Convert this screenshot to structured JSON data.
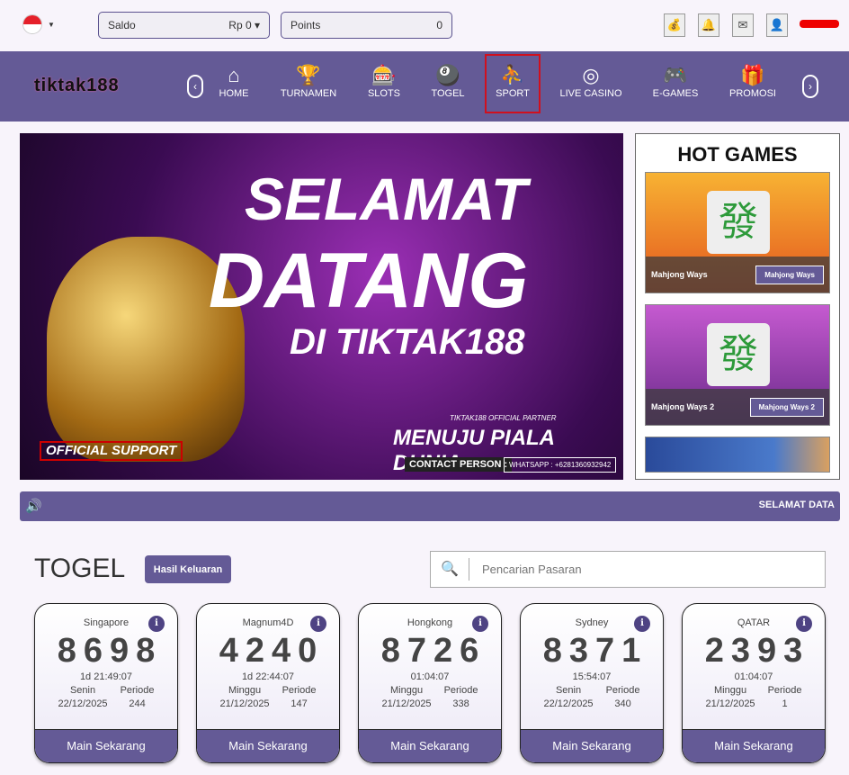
{
  "header": {
    "saldo_label": "Saldo",
    "saldo_value": "Rp 0 ▾",
    "points_label": "Points",
    "points_value": "0"
  },
  "nav": {
    "logo": "tiktak188",
    "items": [
      {
        "label": "HOME",
        "icon": "⌂"
      },
      {
        "label": "TURNAMEN",
        "icon": "🏆"
      },
      {
        "label": "SLOTS",
        "icon": "🎰"
      },
      {
        "label": "TOGEL",
        "icon": "🎱"
      },
      {
        "label": "SPORT",
        "icon": "⛹"
      },
      {
        "label": "LIVE CASINO",
        "icon": "◎"
      },
      {
        "label": "E-GAMES",
        "icon": "🎮"
      },
      {
        "label": "PROMOSI",
        "icon": "🎁"
      }
    ]
  },
  "banner": {
    "line1": "SELAMAT",
    "line2": "DATANG",
    "line3": "DI TIKTAK188",
    "partner": "TIKTAK188 OFFICIAL PARTNER",
    "line4": "MENUJU PIALA DUNIA",
    "contact": "CONTACT PERSON :",
    "whatsapp": "WHATSAPP : +6281360932942",
    "support": "OFFICIAL SUPPORT"
  },
  "hot_games": {
    "title": "HOT GAMES",
    "games": [
      {
        "name": "Mahjong Ways",
        "button": "Mahjong Ways"
      },
      {
        "name": "Mahjong Ways 2",
        "button": "Mahjong Ways 2"
      }
    ]
  },
  "ticker": {
    "text": "SELAMAT DATA"
  },
  "togel": {
    "title": "TOGEL",
    "hasil_button": "Hasil Keluaran",
    "search_placeholder": "Pencarian Pasaran",
    "periode_label": "Periode",
    "play_label": "Main Sekarang",
    "markets": [
      {
        "name": "Singapore",
        "result": "8698",
        "countdown": "1d 21:49:07",
        "day": "Senin",
        "date": "22/12/2025",
        "periode": "244"
      },
      {
        "name": "Magnum4D",
        "result": "4240",
        "countdown": "1d 22:44:07",
        "day": "Minggu",
        "date": "21/12/2025",
        "periode": "147"
      },
      {
        "name": "Hongkong",
        "result": "8726",
        "countdown": "01:04:07",
        "day": "Minggu",
        "date": "21/12/2025",
        "periode": "338"
      },
      {
        "name": "Sydney",
        "result": "8371",
        "countdown": "15:54:07",
        "day": "Senin",
        "date": "22/12/2025",
        "periode": "340"
      },
      {
        "name": "QATAR",
        "result": "2393",
        "countdown": "01:04:07",
        "day": "Minggu",
        "date": "21/12/2025",
        "periode": "1"
      }
    ]
  }
}
